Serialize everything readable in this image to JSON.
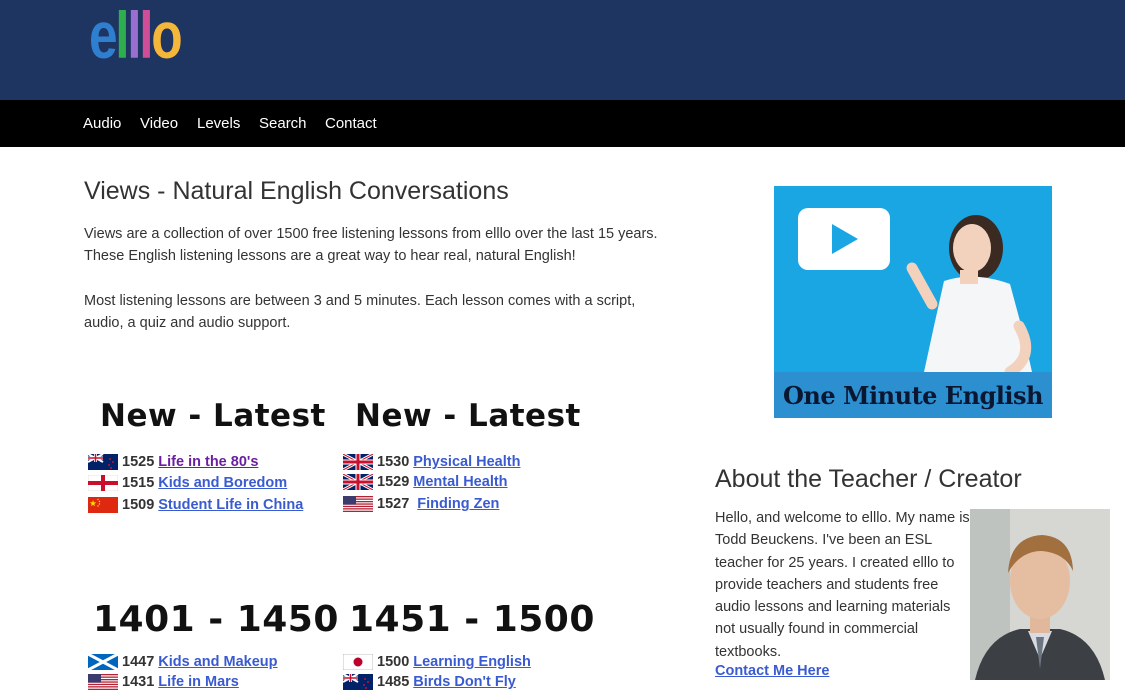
{
  "header": {
    "logo_letters": [
      "e",
      "l",
      "l",
      "l",
      "o"
    ],
    "logo_colors": [
      "#2f7fd0",
      "#2fae4f",
      "#9b6fd0",
      "#d04e97",
      "#f4b73a"
    ],
    "bg_color": "#1e3461"
  },
  "nav": {
    "items": [
      {
        "label": "Audio"
      },
      {
        "label": "Video"
      },
      {
        "label": "Levels"
      },
      {
        "label": "Search"
      },
      {
        "label": "Contact"
      }
    ]
  },
  "main": {
    "title": "Views - Natural English Conversations",
    "intro_1": "Views are a collection of over 1500 free listening lessons from elllo over the last 15 years. These English listening lessons are a great way to hear real, natural English!",
    "intro_2": "Most listening lessons are between 3 and 5 minutes. Each lesson comes with a script, audio, a quiz and audio support."
  },
  "sections": [
    {
      "heading": "New - Latest",
      "lessons": [
        {
          "number": "1525",
          "title": "Life in the 80's",
          "flag": "new-zealand-flag",
          "visited": true
        },
        {
          "number": "1515",
          "title": "Kids and Boredom",
          "flag": "england-flag",
          "visited": false
        },
        {
          "number": "1509",
          "title": "Student Life in China",
          "flag": "china-flag",
          "visited": false
        }
      ]
    },
    {
      "heading": "New - Latest",
      "lessons": [
        {
          "number": "1530",
          "title": "Physical Health",
          "flag": "uk-flag",
          "visited": false
        },
        {
          "number": "1529",
          "title": "Mental Health",
          "flag": "uk-flag",
          "visited": false
        },
        {
          "number": "1527",
          "title": "Finding Zen",
          "flag": "usa-flag",
          "visited": false
        }
      ]
    },
    {
      "heading": "1401 - 1450",
      "lessons": [
        {
          "number": "1447",
          "title": "Kids and Makeup",
          "flag": "scotland-flag",
          "visited": false
        },
        {
          "number": "1431",
          "title": "Life in Mars",
          "flag": "usa-flag",
          "visited": false
        }
      ]
    },
    {
      "heading": "1451 - 1500",
      "lessons": [
        {
          "number": "1500",
          "title": "Learning English",
          "flag": "japan-flag",
          "visited": false
        },
        {
          "number": "1485",
          "title": "Birds Don't Fly",
          "flag": "new-zealand-flag",
          "visited": false
        }
      ]
    }
  ],
  "promo": {
    "caption": "One Minute English",
    "icon": "play-icon"
  },
  "about": {
    "title": "About the Teacher / Creator",
    "text": "Hello, and welcome to elllo. My name is Todd Beuckens. I've been an ESL teacher for 25 years. I created elllo to provide teachers and students free audio lessons and learning materials not usually found in commercial textbooks.",
    "contact_label": "Contact Me Here"
  }
}
